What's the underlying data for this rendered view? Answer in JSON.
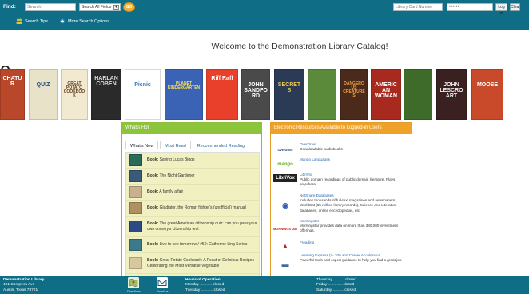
{
  "header": {
    "find_label": "Find:",
    "search_placeholder": "Search",
    "field_select": "Search All Fields",
    "search_tips": "Search Tips",
    "more_options": "More Search Options",
    "card_placeholder": "Library Card Number",
    "pin_value": "••••••",
    "login_label": "Log in",
    "clear_label": "Clear"
  },
  "welcome": "Welcome to the Demonstration Library Catalog!",
  "stray_letter": "e",
  "covers": [
    {
      "title": "CHATUR",
      "bg": "#b9472a",
      "fg": "#fff"
    },
    {
      "title": "QUIZ",
      "bg": "#e8e2c8",
      "fg": "#2b4a86"
    },
    {
      "title": "GREAT POTATO COOKBOOK",
      "bg": "#f1e9d0",
      "fg": "#5b3a1a"
    },
    {
      "title": "HARLAN COBEN",
      "bg": "#2a2a2a",
      "fg": "#ddd"
    },
    {
      "title": "Picnic",
      "bg": "#ffffff",
      "fg": "#2e7bc0"
    },
    {
      "title": "PLANET KINDERGARTEN",
      "bg": "#3a62b5",
      "fg": "#ffe04a"
    },
    {
      "title": "Riff Raff",
      "bg": "#e8402a",
      "fg": "#fff"
    },
    {
      "title": "JOHN SANDFORD",
      "bg": "#4a4a4a",
      "fg": "#fff"
    },
    {
      "title": "SECRETS",
      "bg": "#2b3a55",
      "fg": "#e8c84a"
    },
    {
      "title": "",
      "bg": "#5a8a3a",
      "fg": "#fff"
    },
    {
      "title": "DANGEROUS CREATURES",
      "bg": "#4a2a1a",
      "fg": "#f0a040"
    },
    {
      "title": "AMERICAN WOMAN",
      "bg": "#a82a1e",
      "fg": "#fff"
    },
    {
      "title": "",
      "bg": "#3e6a2a",
      "fg": "#fff"
    },
    {
      "title": "JOHN LESCROART",
      "bg": "#3a2020",
      "fg": "#eee"
    },
    {
      "title": "MOOSE",
      "bg": "#c94a2a",
      "fg": "#fff"
    }
  ],
  "whats_hot": {
    "title": "What's Hot",
    "tabs": [
      "What's New",
      "Most Read",
      "Recommended Reading"
    ],
    "items": [
      {
        "kind": "Book:",
        "title": "Saving Lucas Biggs",
        "color": "#2a6a5a"
      },
      {
        "kind": "Book:",
        "title": "The Night Gardener",
        "color": "#3a5a7a"
      },
      {
        "kind": "Book:",
        "title": "A family affair",
        "color": "#c8b090"
      },
      {
        "kind": "Book:",
        "title": "Gladiator, the Roman fighter's (unofficial) manual",
        "color": "#b09060"
      },
      {
        "kind": "Book:",
        "title": "The great American citizenship quiz: can you pass your own country's citizenship test",
        "color": "#2b4a86"
      },
      {
        "kind": "Book:",
        "title": "Live to see tomorrow / #50: Catherine Ling Series",
        "color": "#3a7a8a"
      },
      {
        "kind": "Book:",
        "title": "Great Potato Cookbook: A Feast of Delicious Recipes Celebrating the Most Versatile Vegetable",
        "color": "#d8c8a0"
      },
      {
        "kind": "Book:",
        "title": "Live now / #60: Nyren Bolder Series",
        "color": "#4a6a3a"
      }
    ]
  },
  "resources": {
    "title": "Electronic Resources Available to Logged-in Users",
    "items": [
      {
        "logo": "OverDrive",
        "logo_color": "#1a3a7a",
        "name": "OverDrive",
        "desc": "Downloadable audiobooks"
      },
      {
        "logo": "mango",
        "logo_color": "#6aaa2a",
        "name": "Mango Languages",
        "desc": ""
      },
      {
        "logo": "LibriVox",
        "logo_color": "#ffffff",
        "name": "LibriVox",
        "desc": "Public domain recordings of public domain literature. Plays anywhere"
      },
      {
        "logo": "◉",
        "logo_color": "#2a5ab0",
        "name": "NetShare Databases",
        "desc": "Includes thousands of full-text magazines and newspapers, WorldCat (85 million library records), Science and Literature databases, online encyclopedias, etc."
      },
      {
        "logo": "MORNINGSTAR",
        "logo_color": "#c0201e",
        "name": "Morningstar",
        "desc": "Morningstar provides data on more than 380,000 investment offerings."
      },
      {
        "logo": "▲",
        "logo_color": "#c0201e",
        "name": "Freading",
        "desc": ""
      },
      {
        "logo": "▬",
        "logo_color": "#3a6aa0",
        "name": "Learning Express (I - 300 and Career Accelerator",
        "desc": "Powerful tools and expert guidance to help you find a great job."
      }
    ]
  },
  "footer": {
    "library": "Demonstration Library",
    "address1": "401 Congress Ave",
    "address2": "Austin, Texas 78701",
    "map_label": "Directions",
    "email_label": "Email us",
    "hours_title": "Hours of Operation:",
    "hours_left": [
      "Monday ........... closed",
      "Tuesday ........... closed"
    ],
    "hours_right": [
      "Thursday .......... closed",
      "Friday ............. closed",
      "Saturday .......... closed"
    ]
  }
}
